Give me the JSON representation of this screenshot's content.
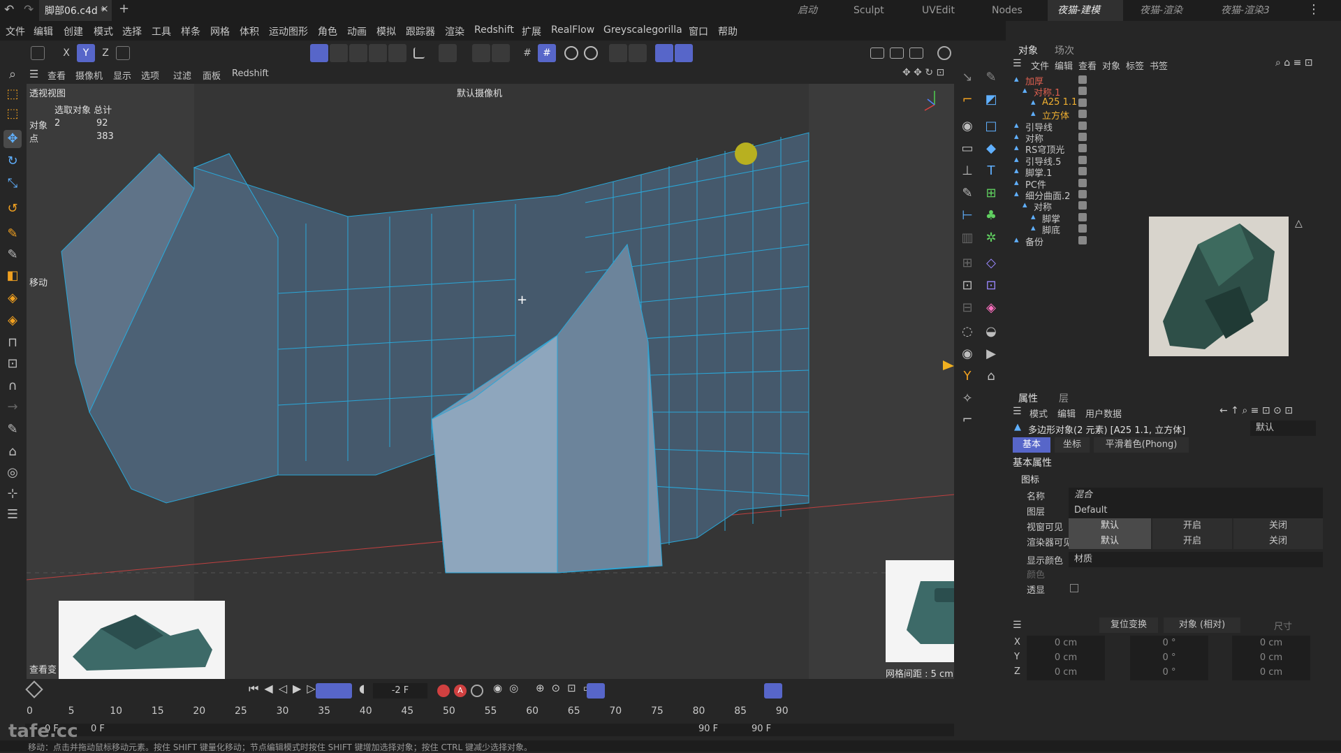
{
  "title_tabs": {
    "file": "脚部06.c4d *",
    "close": "×",
    "add": "+"
  },
  "layout_tabs": [
    "启动",
    "Sculpt",
    "UVEdit",
    "Nodes",
    "夜猫-建模",
    "夜猫-渲染",
    "夜猫-渲染3"
  ],
  "menu": [
    "文件",
    "编辑",
    "创建",
    "模式",
    "选择",
    "工具",
    "样条",
    "网格",
    "体积",
    "运动图形",
    "角色",
    "动画",
    "模拟",
    "跟踪器",
    "渲染",
    "Redshift",
    "扩展",
    "RealFlow",
    "Greyscalegorilla",
    "窗口",
    "帮助"
  ],
  "axis_toggles": [
    "X",
    "Y",
    "Z"
  ],
  "viewport_menu": [
    "查看",
    "摄像机",
    "显示",
    "选项",
    "过滤",
    "面板",
    "Redshift"
  ],
  "viewport": {
    "view_name": "透视视图",
    "camera_label": "默认摄像机",
    "move_label": "移动",
    "query_label": "查看变",
    "stats_header": "选取对象 总计",
    "stats": [
      {
        "label": "对象",
        "sel": "2",
        "total": "92"
      },
      {
        "label": "点",
        "sel": "",
        "total": "383"
      }
    ],
    "grid_spacing": "网格间距 : 5 cm"
  },
  "object_panel": {
    "tabs": [
      "对象",
      "场次"
    ],
    "menu": [
      "文件",
      "编辑",
      "查看",
      "对象",
      "标签",
      "书签"
    ],
    "items": [
      {
        "name": "加厚",
        "color": "#e06050",
        "indent": 0
      },
      {
        "name": "对称.1",
        "color": "#e06050",
        "indent": 1
      },
      {
        "name": "A25 1.1",
        "color": "#f0b030",
        "indent": 2
      },
      {
        "name": "立方体",
        "color": "#f0b030",
        "indent": 2
      },
      {
        "name": "引导线",
        "color": "#c8c8c8",
        "indent": 0
      },
      {
        "name": "对称",
        "color": "#c8c8c8",
        "indent": 0
      },
      {
        "name": "RS穹顶光",
        "color": "#c8c8c8",
        "indent": 0
      },
      {
        "name": "引导线.5",
        "color": "#c8c8c8",
        "indent": 0
      },
      {
        "name": "脚掌.1",
        "color": "#c8c8c8",
        "indent": 0
      },
      {
        "name": "PC件",
        "color": "#c8c8c8",
        "indent": 0
      },
      {
        "name": "细分曲面.2",
        "color": "#c8c8c8",
        "indent": 0
      },
      {
        "name": "对称",
        "color": "#c8c8c8",
        "indent": 1
      },
      {
        "name": "脚掌",
        "color": "#c8c8c8",
        "indent": 2
      },
      {
        "name": "脚底",
        "color": "#c8c8c8",
        "indent": 2
      },
      {
        "name": "备份",
        "color": "#c8c8c8",
        "indent": 0
      }
    ]
  },
  "attr_panel": {
    "tabs": [
      "属性",
      "层"
    ],
    "menu": [
      "模式",
      "编辑",
      "用户数据"
    ],
    "object_desc": "多边形对象(2 元素) [A25 1.1, 立方体]",
    "preset": "默认",
    "subtabs": [
      "基本",
      "坐标",
      "平滑着色(Phong)"
    ],
    "section": "基本属性",
    "group": "图标",
    "fields": {
      "name_label": "名称",
      "name_value": "混合",
      "layer_label": "图层",
      "layer_value": "Default",
      "vis_label": "视窗可见",
      "render_label": "渲染器可见",
      "color_label": "显示颜色",
      "color_value": "材质",
      "col_label": "颜色",
      "trans_label": "透显"
    },
    "tri": [
      "默认",
      "开启",
      "关闭"
    ],
    "coords": {
      "reset": "复位变换",
      "mode": "对象 (相对)",
      "size": "尺寸",
      "rows": [
        {
          "axis": "X",
          "p": "0 cm",
          "r": "0 °",
          "s": "0 cm"
        },
        {
          "axis": "Y",
          "p": "0 cm",
          "r": "0 °",
          "s": "0 cm"
        },
        {
          "axis": "Z",
          "p": "0 cm",
          "r": "0 °",
          "s": "0 cm"
        }
      ]
    }
  },
  "timeline": {
    "current": "-2 F",
    "ticks": [
      "0",
      "5",
      "10",
      "15",
      "20",
      "25",
      "30",
      "35",
      "40",
      "45",
      "50",
      "55",
      "60",
      "65",
      "70",
      "75",
      "80",
      "85",
      "90"
    ],
    "start": "0 F",
    "start2": "0 F",
    "end": "90 F",
    "end2": "90 F"
  },
  "status": "移动：点击并拖动鼠标移动元素。按住 SHIFT 键量化移动；节点编辑模式时按住 SHIFT 键增加选择对象；按住 CTRL 键减少选择对象。",
  "watermark": "tafe.cc",
  "colors": {
    "accent": "#5766c9",
    "mesh": "#5d7389",
    "wire": "#2aa7d8",
    "red": "#e04040"
  }
}
